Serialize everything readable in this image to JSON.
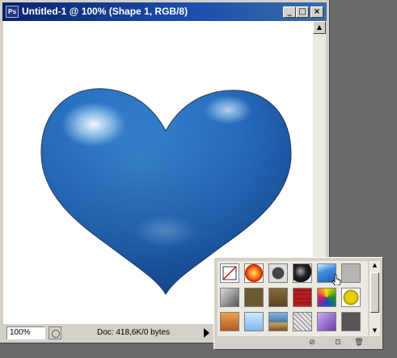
{
  "window": {
    "title": "Untitled-1 @ 100% (Shape 1, RGB/8)",
    "app_icon_label": "Ps",
    "minimize_label": "_",
    "maximize_label": "□",
    "close_label": "×"
  },
  "canvas": {
    "shape": "heart",
    "fill_colors": [
      "#1d5fb4",
      "#3f8fd8",
      "#aee0ff"
    ]
  },
  "status_bar": {
    "zoom": "100%",
    "doc_info": "Doc: 418,6K/0 bytes"
  },
  "styles_palette": {
    "swatches": [
      {
        "name": "no-style"
      },
      {
        "name": "orange-glow"
      },
      {
        "name": "gray-bevel"
      },
      {
        "name": "black-button"
      },
      {
        "name": "blue-glass"
      },
      {
        "name": "gray-flat"
      },
      {
        "name": "metal-gradient"
      },
      {
        "name": "olive-bevel"
      },
      {
        "name": "bronze-bevel"
      },
      {
        "name": "red-brick"
      },
      {
        "name": "multicolor"
      },
      {
        "name": "gold-frame"
      },
      {
        "name": "copper-gradient"
      },
      {
        "name": "light-blue-glass"
      },
      {
        "name": "sky-photo"
      },
      {
        "name": "silver-texture"
      },
      {
        "name": "purple-bevel"
      },
      {
        "name": "dark-gray"
      }
    ],
    "footer_icons": [
      "clear-style",
      "new-style",
      "delete-style"
    ]
  },
  "colors": {
    "titlebar": "#0a246a",
    "window_bg": "#d4d0c8",
    "desktop": "#6b6b6b"
  }
}
